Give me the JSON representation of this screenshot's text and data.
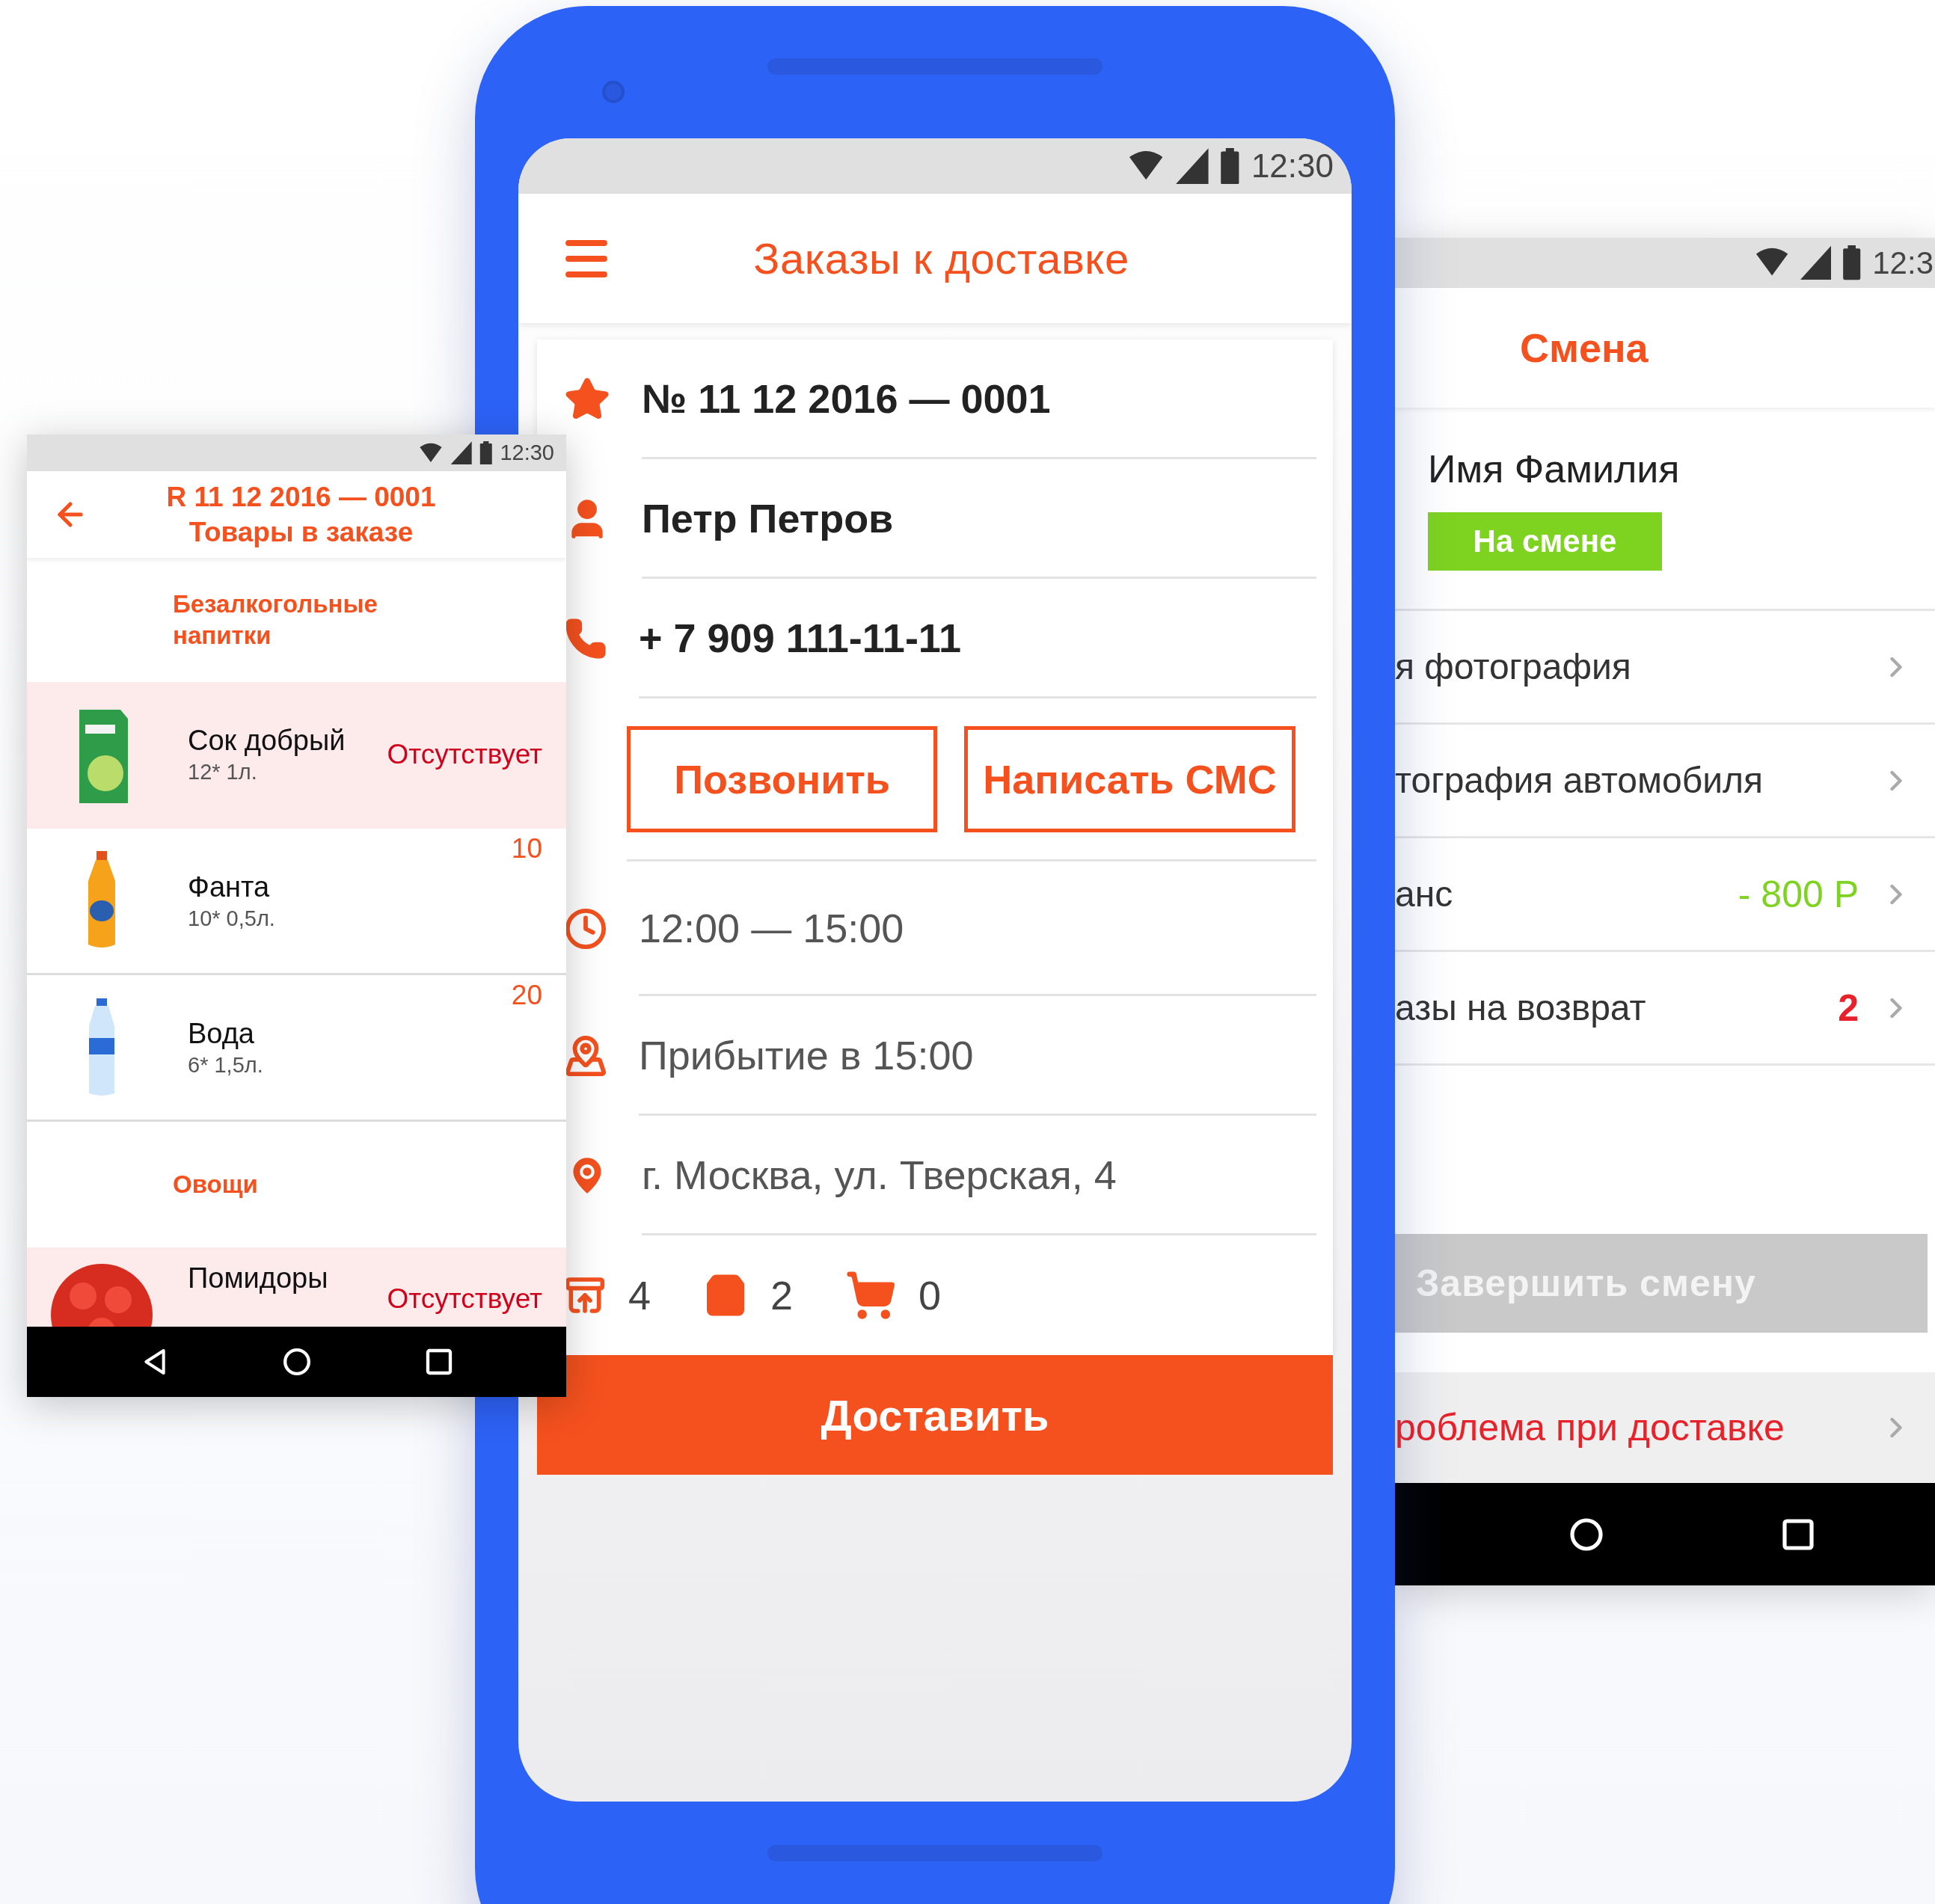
{
  "center_phone": {
    "status_bar": {
      "time": "12:30"
    },
    "title": "Заказы к доставке",
    "order": {
      "number": "№ 11 12 2016 — 0001",
      "customer": "Петр Петров",
      "phone": "+ 7 909 111-11-11",
      "actions": [
        "Позвонить",
        "Написать СМС"
      ],
      "time_window": "12:00 — 15:00",
      "arrival": "Прибытие в 15:00",
      "address": "г. Москва, ул. Тверская, 4",
      "counts": [
        {
          "kind": "box",
          "value": "4"
        },
        {
          "kind": "bag",
          "value": "2"
        },
        {
          "kind": "cart",
          "value": "0"
        }
      ]
    },
    "deliver_button": "Доставить"
  },
  "left_phone": {
    "status_bar": {
      "time": "12:30"
    },
    "title": "R 11 12 2016 — 0001",
    "subtitle": "Товары в заказе",
    "sections": [
      {
        "category": "Безалкогольные напитки",
        "items": [
          {
            "kind": "carton",
            "name": "Сок добрый",
            "pack": "12* 1л.",
            "status": "Отсутствует",
            "missing": true
          },
          {
            "kind": "bottle",
            "name": "Фанта",
            "pack": "10* 0,5л.",
            "status": "10",
            "missing": false
          },
          {
            "kind": "water",
            "name": "Вода",
            "pack": "6* 1,5л.",
            "status": "20",
            "missing": false
          }
        ]
      },
      {
        "category": "Овощи",
        "items": [
          {
            "kind": "tomato",
            "name": "Помидоры",
            "status": "Отсутствует",
            "missing": true
          }
        ]
      }
    ]
  },
  "right_phone": {
    "status_bar": {
      "time": "12:3"
    },
    "title": "Смена",
    "user": {
      "name": "Имя Фамилия",
      "status": "На смене"
    },
    "menu": [
      {
        "label": "я фотография"
      },
      {
        "label": "тография автомобиля"
      },
      {
        "label": "анс",
        "value": "- 800 Р",
        "kind": "positive"
      },
      {
        "label": "азы на возврат",
        "value": "2",
        "kind": "negative"
      }
    ],
    "end_shift_button": {
      "label": "Завершить смену",
      "disabled": true
    },
    "problem_item": "роблема при доставке"
  }
}
